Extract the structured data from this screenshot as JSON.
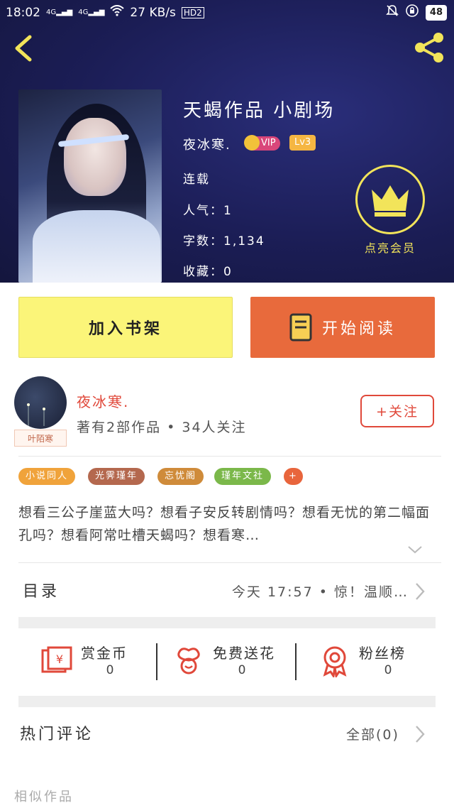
{
  "status_bar": {
    "time": "18:02",
    "network_1": "4G",
    "network_2": "4G",
    "speed": "27 KB/s",
    "hd": "HD2",
    "battery": "48"
  },
  "book": {
    "title": "天蝎作品 小剧场",
    "author": "夜冰寒.",
    "vip_label": "VIP",
    "level_label": "Lv3",
    "status": "连载",
    "popularity": "人气：1",
    "word_count": "字数：1,134",
    "favorites": "收藏：0"
  },
  "member": {
    "label": "点亮会员"
  },
  "actions": {
    "add_to_shelf": "加入书架",
    "start_reading": "开始阅读"
  },
  "author_card": {
    "name": "夜冰寒.",
    "avatar_tag": "叶陌寒",
    "stats": "著有2部作品 • 34人关注",
    "follow_label": "+关注"
  },
  "tags": [
    {
      "label": "小说同人",
      "color": "#f0a33b"
    },
    {
      "label": "光霁瑾年",
      "color": "#b4684e"
    },
    {
      "label": "忘忧阁",
      "color": "#cf8b3a"
    },
    {
      "label": "瑾年文社",
      "color": "#7bb84a"
    },
    {
      "label": "+",
      "color": "#e8653c"
    }
  ],
  "description": "想看三公子崖蓝大吗？想看子安反转剧情吗？想看无忧的第二幅面孔吗？想看阿常吐槽天蝎吗？想看寒…",
  "catalog": {
    "label": "目录",
    "latest": "今天  17:57  •  惊！温顺…"
  },
  "stats": [
    {
      "title": "赏金币",
      "value": "0",
      "icon": "red-envelope-icon"
    },
    {
      "title": "免费送花",
      "value": "0",
      "icon": "flower-icon"
    },
    {
      "title": "粉丝榜",
      "value": "0",
      "icon": "medal-icon"
    }
  ],
  "comments": {
    "label": "热门评论",
    "all_label": "全部(0)"
  },
  "similar": {
    "label": "相似作品"
  },
  "colors": {
    "header_bg": "#1b1d55",
    "accent_red": "#e0483a",
    "read_button": "#e86a3c",
    "shelf_button": "#fbf579",
    "member_gold": "#f2e45a"
  }
}
